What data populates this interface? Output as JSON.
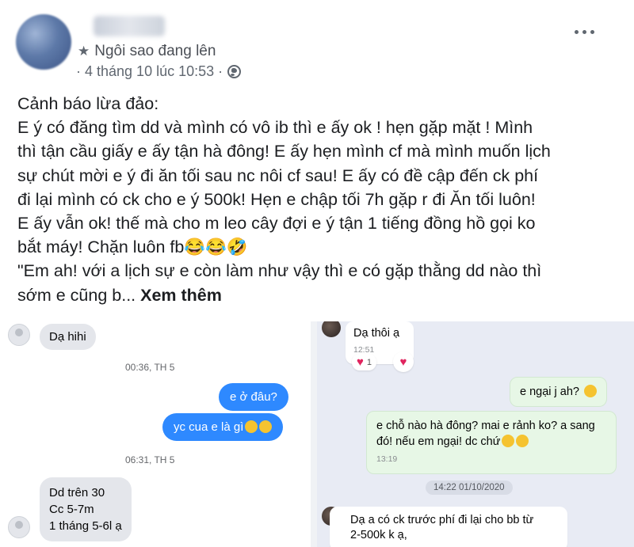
{
  "post": {
    "badge": "Ngôi sao đang lên",
    "meta": "· 4 tháng 10 lúc 10:53 ·",
    "lines": [
      "Cảnh báo lừa đảo:",
      "E ý có đăng tìm dd và mình có vô ib thì e ấy ok ! hẹn gặp mặt ! Mình",
      "thì tận cầu giấy e ấy tận hà đông! E ấy hẹn mình cf mà mình muốn lịch",
      "sự chút mời e ý đi ăn tối sau nc nôi cf sau! E ấy  có đề cập đến ck phí",
      "đi lại mình có ck cho e ý 500k! Hẹn e chập tối 7h gặp r đi Ăn tối luôn!",
      "E ấy vẫn ok! thế mà cho m leo cây đợi e ý tận 1 tiếng đồng hồ gọi ko",
      "bắt máy! Chặn luôn  fb😂😂🤣",
      " \"Em ah! với a lịch sự e còn làm như vậy thì e có gặp thằng dd nào thì",
      "sớm e cũng b... "
    ],
    "see_more": "Xem thêm"
  },
  "left_chat": {
    "msg1": "Dạ hihi",
    "time1": "00:36, TH 5",
    "msg2": "e ở đâu?",
    "msg3": "yc cua e là gì",
    "time2": "06:31, TH 5",
    "msg4": [
      "Dd trên 30",
      "Cc 5-7m",
      "1 tháng 5-6l ạ"
    ]
  },
  "right_chat": {
    "msg1": "Dạ thôi ạ",
    "msg1_time": "12:51",
    "reaction_count": "1",
    "msg2": "e ngại j ah?",
    "msg3_line1": "e chỗ nào hà đông? mai e rảnh ko? a sang",
    "msg3_line2": "đó! nếu em ngại! dc chứ",
    "msg3_time": "13:19",
    "date_pill": "14:22 01/10/2020",
    "msg4_line1": "Dạ a có ck trước phí đi lại cho bb từ",
    "msg4_line2": "2-500k k ạ,"
  },
  "colors": {
    "messenger_blue": "#2e89ff",
    "zalo_bg": "#e8ebf4",
    "zalo_sent": "#e7f7e6"
  },
  "icons": [
    "star-icon",
    "globe-icon",
    "more-options-icon",
    "heart-icon",
    "emoji-icon"
  ]
}
